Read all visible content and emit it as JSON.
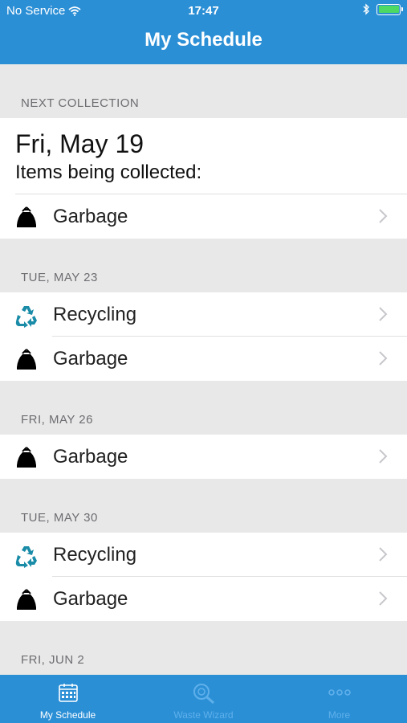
{
  "status_bar": {
    "carrier": "No Service",
    "time": "17:47"
  },
  "nav": {
    "title": "My Schedule"
  },
  "next_collection": {
    "header": "NEXT COLLECTION",
    "date": "Fri, May 19",
    "items_label": "Items being collected:",
    "items": [
      {
        "label": "Garbage",
        "icon": "garbage-bag-icon"
      }
    ]
  },
  "schedule": [
    {
      "header": "TUE, MAY 23",
      "items": [
        {
          "label": "Recycling",
          "icon": "recycling-icon"
        },
        {
          "label": "Garbage",
          "icon": "garbage-bag-icon"
        }
      ]
    },
    {
      "header": "FRI, MAY 26",
      "items": [
        {
          "label": "Garbage",
          "icon": "garbage-bag-icon"
        }
      ]
    },
    {
      "header": "TUE, MAY 30",
      "items": [
        {
          "label": "Recycling",
          "icon": "recycling-icon"
        },
        {
          "label": "Garbage",
          "icon": "garbage-bag-icon"
        }
      ]
    },
    {
      "header": "FRI, JUN 2",
      "items": []
    }
  ],
  "tabs": [
    {
      "label": "My Schedule",
      "icon": "calendar-icon",
      "active": true
    },
    {
      "label": "Waste Wizard",
      "icon": "magnifier-icon",
      "active": false
    },
    {
      "label": "More",
      "icon": "more-dots-icon",
      "active": false
    }
  ],
  "colors": {
    "brand": "#2b8fd6",
    "recycling": "#1a8ca8",
    "tab_inactive": "#5fb0ea"
  }
}
